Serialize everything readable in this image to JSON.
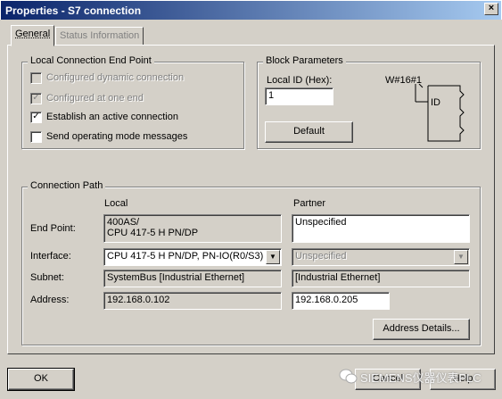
{
  "window": {
    "title": "Properties - S7 connection",
    "close_glyph": "×"
  },
  "tabs": [
    {
      "label": "General"
    },
    {
      "label": "Status Information"
    }
  ],
  "local_endpoint": {
    "legend": "Local Connection End Point",
    "options": [
      {
        "label": "Configured dynamic connection",
        "checked": false,
        "enabled": false,
        "mark": ""
      },
      {
        "label": "Configured at one end",
        "checked": true,
        "enabled": false,
        "mark": "✓"
      },
      {
        "label": "Establish an active connection",
        "checked": true,
        "enabled": true,
        "mark": "✓"
      },
      {
        "label": "Send operating mode messages",
        "checked": false,
        "enabled": true,
        "mark": ""
      }
    ]
  },
  "block_params": {
    "legend": "Block Parameters",
    "local_id_label": "Local ID (Hex):",
    "local_id_value": "1",
    "block_value": "W#16#1",
    "block_pin": "ID",
    "default_button": "Default"
  },
  "connection_path": {
    "legend": "Connection Path",
    "col_local": "Local",
    "col_partner": "Partner",
    "rows": {
      "endpoint_label": "End Point:",
      "interface_label": "Interface:",
      "subnet_label": "Subnet:",
      "address_label": "Address:"
    },
    "local": {
      "endpoint_line1": "400AS/",
      "endpoint_line2": "CPU 417-5 H PN/DP",
      "interface": "CPU 417-5 H PN/DP, PN-IO(R0/S3)",
      "subnet": "SystemBus [Industrial Ethernet]",
      "address": "192.168.0.102"
    },
    "partner": {
      "endpoint": "Unspecified",
      "interface": "Unspecified",
      "subnet": "[Industrial Ethernet]",
      "address": "192.168.0.205"
    },
    "address_details_button": "Address Details..."
  },
  "footer": {
    "ok_button": "OK",
    "cancel_button": "Cancel",
    "help_button": "Help"
  },
  "watermark": {
    "text": "SIEMENS仪器仪表PLC"
  },
  "icons": {
    "dropdown": "▼"
  }
}
